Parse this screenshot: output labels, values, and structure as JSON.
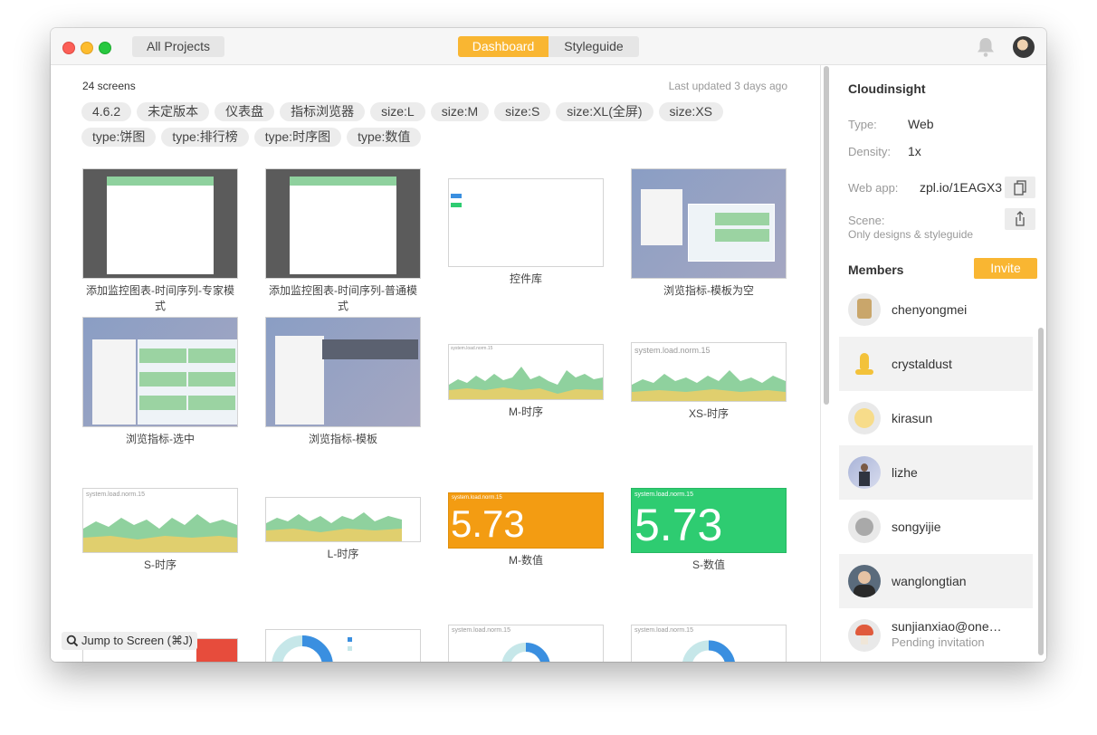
{
  "titlebar": {
    "all_projects_label": "All Projects",
    "tabs": [
      {
        "label": "Dashboard",
        "active": true
      },
      {
        "label": "Styleguide",
        "active": false
      }
    ],
    "accent_color": "#f9b632"
  },
  "main": {
    "screens_count": "24 screens",
    "last_updated": "Last updated 3 days ago",
    "tags": [
      "4.6.2",
      "未定版本",
      "仪表盘",
      "指标浏览器",
      "size:L",
      "size:M",
      "size:S",
      "size:XL(全屏)",
      "size:XS",
      "type:饼图",
      "type:排行榜",
      "type:时序图",
      "type:数值"
    ],
    "screens": [
      {
        "caption": "添加监控图表-时间序列-专家模式"
      },
      {
        "caption": "添加监控图表-时间序列-普通模式"
      },
      {
        "caption": "控件库"
      },
      {
        "caption": "浏览指标-模板为空"
      },
      {
        "caption": "浏览指标-选中"
      },
      {
        "caption": "浏览指标-模板"
      },
      {
        "caption": "M-时序",
        "chart_label": "system.load.norm.15"
      },
      {
        "caption": "XS-时序",
        "chart_label": "system.load.norm.15"
      },
      {
        "caption": "S-时序",
        "chart_label": "system.load.norm.15"
      },
      {
        "caption": "L-时序"
      },
      {
        "caption": "M-数值",
        "value": "5.73",
        "color": "#f39c12",
        "chart_label": "system.load.norm.15"
      },
      {
        "caption": "S-数值",
        "value": "5.73",
        "color": "#2ecc71",
        "chart_label": "system.load.norm.15"
      }
    ],
    "partial_labels": [
      "system.load.norm.15",
      "system.load.norm.15"
    ],
    "jump_label": "Jump to Screen (⌘J)"
  },
  "sidebar": {
    "project_name": "Cloudinsight",
    "type_key": "Type:",
    "type_value": "Web",
    "density_key": "Density:",
    "density_value": "1x",
    "webapp_key": "Web app:",
    "webapp_value": "zpl.io/1EAGX3",
    "scene_key": "Scene:",
    "scene_value": "Only designs & styleguide",
    "members_title": "Members",
    "invite_label": "Invite",
    "members": [
      {
        "name": "chenyongmei"
      },
      {
        "name": "crystaldust"
      },
      {
        "name": "kirasun"
      },
      {
        "name": "lizhe"
      },
      {
        "name": "songyijie"
      },
      {
        "name": "wanglongtian"
      },
      {
        "name": "sunjianxiao@one…",
        "status": "Pending invitation"
      }
    ]
  }
}
